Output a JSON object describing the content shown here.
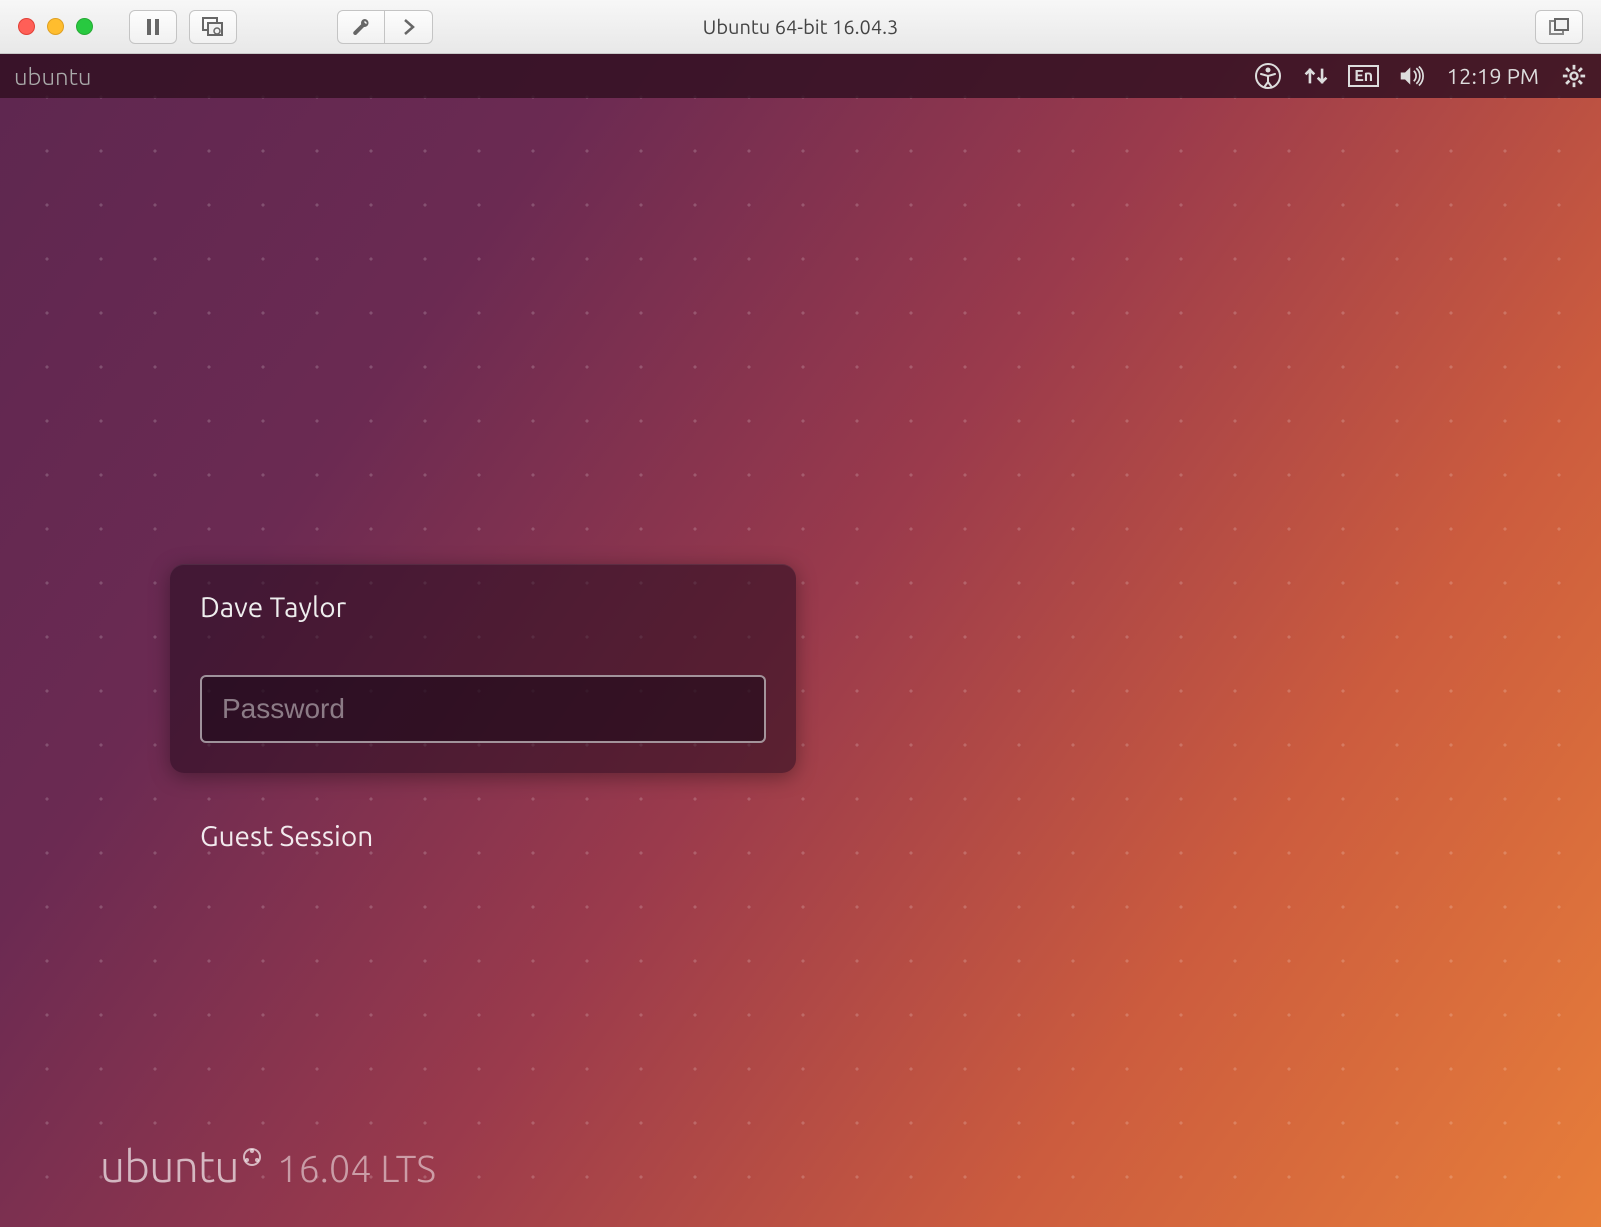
{
  "mac": {
    "title": "Ubuntu 64-bit 16.04.3"
  },
  "menubar": {
    "brand": "ubuntu",
    "input_lang": "En",
    "time": "12:19 PM"
  },
  "login": {
    "username": "Dave Taylor",
    "password_placeholder": "Password",
    "guest_label": "Guest Session"
  },
  "footer": {
    "brand": "ubuntu",
    "version": "16.04 LTS"
  }
}
